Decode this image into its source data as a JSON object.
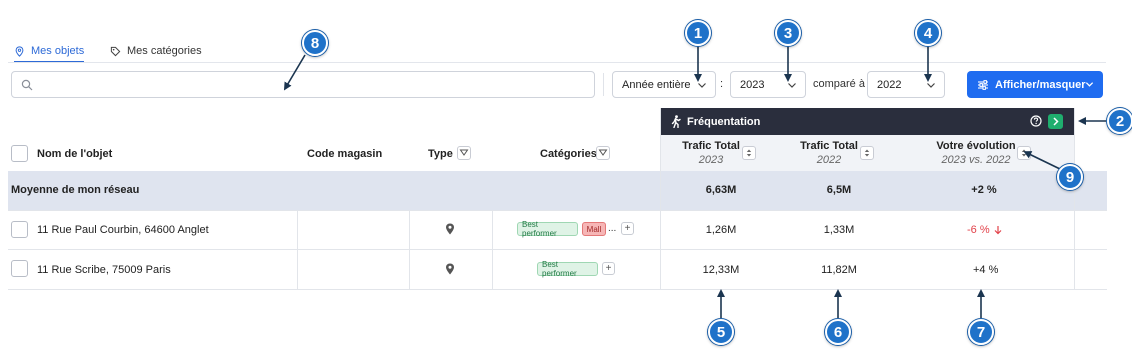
{
  "tabs": [
    {
      "label": "Mes objets",
      "icon": "map-pin-icon",
      "active": true
    },
    {
      "label": "Mes catégories",
      "icon": "tag-icon",
      "active": false
    }
  ],
  "search": {
    "placeholder": "",
    "value": ""
  },
  "filters": {
    "period": "Année entière",
    "separator": ":",
    "year": "2023",
    "compare_label": "comparé à",
    "compare_year": "2022"
  },
  "toggle_button": {
    "label": "Afficher/masquer",
    "icon": "sliders-icon"
  },
  "frequentation": {
    "title": "Fréquentation",
    "icon": "walking-person-icon"
  },
  "columns": {
    "name": "Nom de l'objet",
    "code": "Code magasin",
    "type": "Type",
    "categories": "Catégories",
    "traffic1": {
      "title": "Trafic Total",
      "sub": "2023"
    },
    "traffic2": {
      "title": "Trafic Total",
      "sub": "2022"
    },
    "evolution": {
      "title": "Votre évolution",
      "sub": "2023  vs.  2022"
    }
  },
  "average_row": {
    "label": "Moyenne de mon réseau",
    "traffic1": "6,63M",
    "traffic2": "6,5M",
    "evolution": "+2 %"
  },
  "rows": [
    {
      "name": "11 Rue Paul Courbin, 64600 Anglet",
      "code": "",
      "type_icon": "location-pin-icon",
      "tags": [
        "Best performer",
        "Mall"
      ],
      "ellipsis": "...",
      "plus": "+",
      "traffic1": "1,26M",
      "traffic2": "1,33M",
      "evolution": "-6 %",
      "trend": "down"
    },
    {
      "name": "11 Rue Scribe, 75009 Paris",
      "code": "",
      "type_icon": "location-pin-icon",
      "tags": [
        "Best performer"
      ],
      "plus": "+",
      "traffic1": "12,33M",
      "traffic2": "11,82M",
      "evolution": "+4 %",
      "trend": "up"
    }
  ],
  "callouts": [
    "1",
    "2",
    "3",
    "4",
    "5",
    "6",
    "7",
    "8",
    "9"
  ],
  "colors": {
    "accent": "#1f6cf0",
    "header_dark": "#2a2e3d",
    "average_row": "#dfe4ef",
    "negative": "#e2424a",
    "tag_green": "#dff3e6",
    "tag_red": "#f6b6b6",
    "callout": "#1f72c9"
  }
}
